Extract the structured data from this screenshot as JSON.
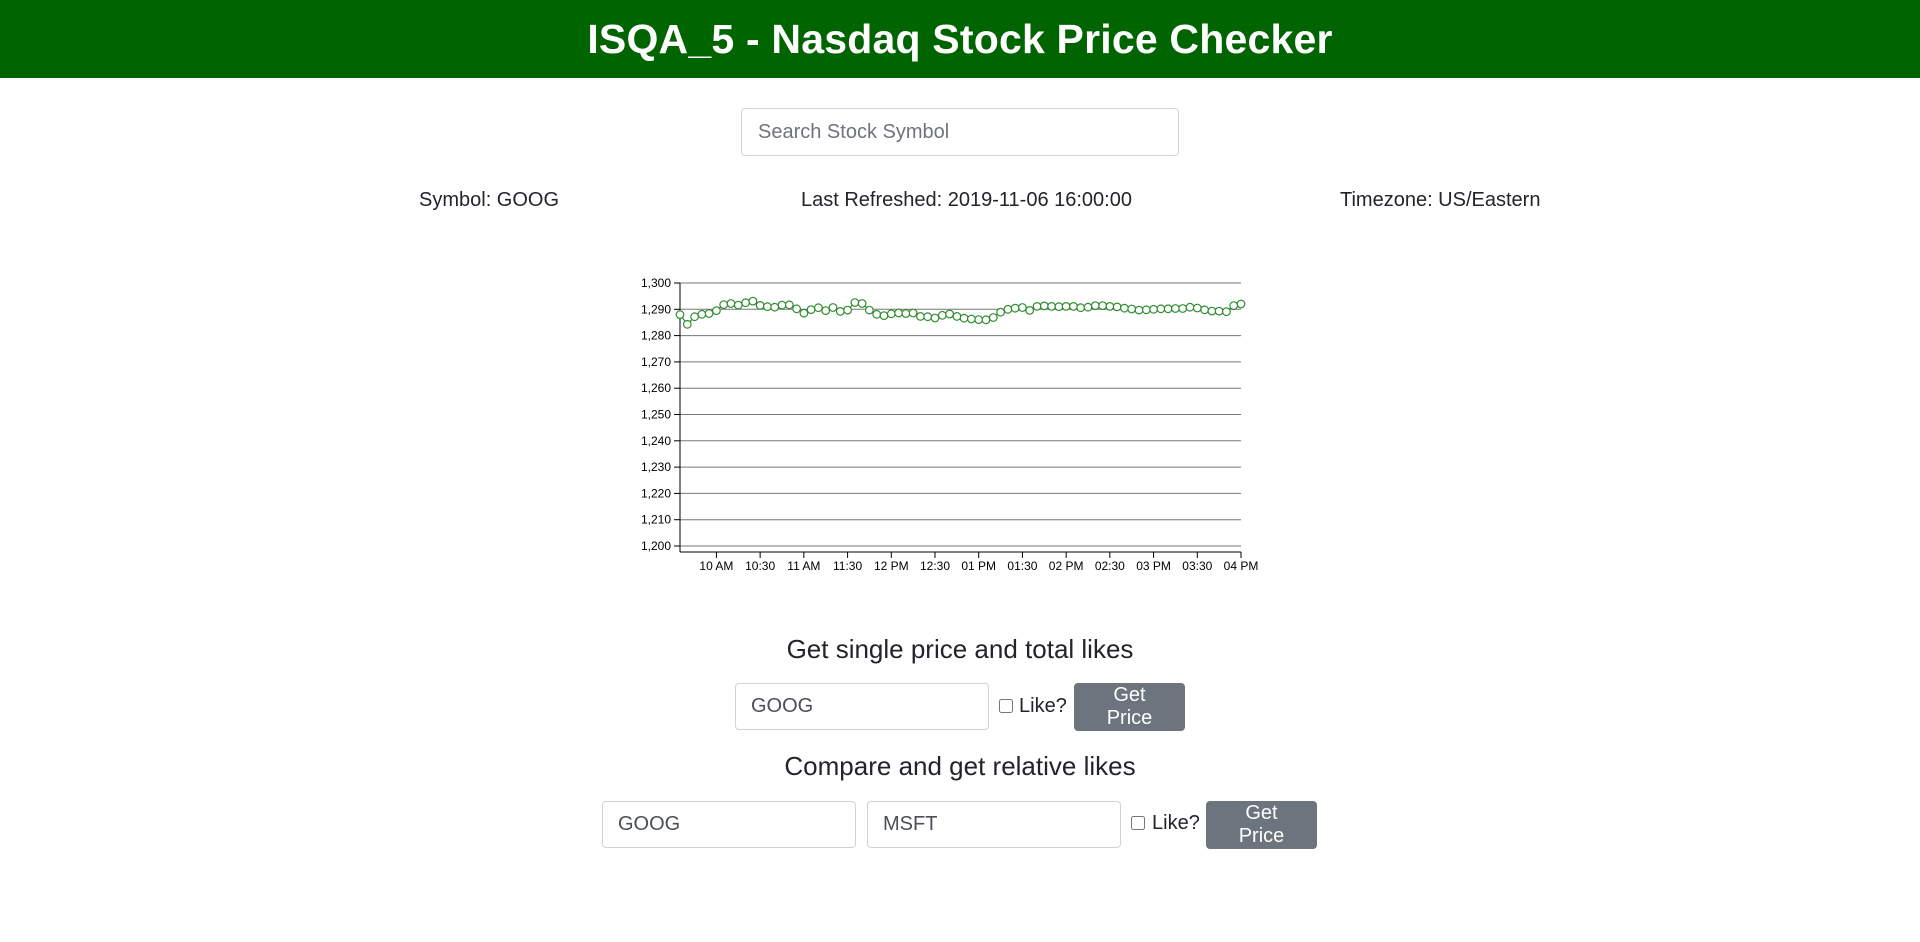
{
  "header": {
    "title": "ISQA_5 - Nasdaq Stock Price Checker"
  },
  "search": {
    "placeholder": "Search Stock Symbol",
    "value": ""
  },
  "info": {
    "symbol": "Symbol: GOOG",
    "last_refreshed": "Last Refreshed: 2019-11-06 16:00:00",
    "timezone": "Timezone: US/Eastern"
  },
  "colors": {
    "header_bg": "#006400",
    "line": "#2e8b2e",
    "button": "#6c757d"
  },
  "chart_data": {
    "type": "line",
    "title": "",
    "xlabel": "",
    "ylabel": "",
    "ylim": [
      1200,
      1300
    ],
    "yticks": [
      1200,
      1210,
      1220,
      1230,
      1240,
      1250,
      1260,
      1270,
      1280,
      1290,
      1300
    ],
    "ytick_labels": [
      "1,200",
      "1,210",
      "1,220",
      "1,230",
      "1,240",
      "1,250",
      "1,260",
      "1,270",
      "1,280",
      "1,290",
      "1,300"
    ],
    "xlim": [
      "09:35",
      "16:00"
    ],
    "xticks": [
      "10:00",
      "10:30",
      "11:00",
      "11:30",
      "12:00",
      "12:30",
      "13:00",
      "13:30",
      "14:00",
      "14:30",
      "15:00",
      "15:30",
      "16:00"
    ],
    "xtick_labels": [
      "10 AM",
      "10:30",
      "11 AM",
      "11:30",
      "12 PM",
      "12:30",
      "01 PM",
      "01:30",
      "02 PM",
      "02:30",
      "03 PM",
      "03:30",
      "04 PM"
    ],
    "grid": true,
    "markers": "open-circle",
    "series": [
      {
        "x": [
          "09:35",
          "09:40",
          "09:45",
          "09:50",
          "09:55",
          "10:00",
          "10:05",
          "10:10",
          "10:15",
          "10:20",
          "10:25",
          "10:30",
          "10:35",
          "10:40",
          "10:45",
          "10:50",
          "10:55",
          "11:00",
          "11:05",
          "11:10",
          "11:15",
          "11:20",
          "11:25",
          "11:30",
          "11:35",
          "11:40",
          "11:45",
          "11:50",
          "11:55",
          "12:00",
          "12:05",
          "12:10",
          "12:15",
          "12:20",
          "12:25",
          "12:30",
          "12:35",
          "12:40",
          "12:45",
          "12:50",
          "12:55",
          "13:00",
          "13:05",
          "13:10",
          "13:15",
          "13:20",
          "13:25",
          "13:30",
          "13:35",
          "13:40",
          "13:45",
          "13:50",
          "13:55",
          "14:00",
          "14:05",
          "14:10",
          "14:15",
          "14:20",
          "14:25",
          "14:30",
          "14:35",
          "14:40",
          "14:45",
          "14:50",
          "14:55",
          "15:00",
          "15:05",
          "15:10",
          "15:15",
          "15:20",
          "15:25",
          "15:30",
          "15:35",
          "15:40",
          "15:45",
          "15:50",
          "15:55",
          "16:00"
        ],
        "values": [
          1288.0,
          1284.3,
          1287.2,
          1288.1,
          1288.4,
          1289.5,
          1291.8,
          1292.2,
          1291.6,
          1292.5,
          1293.1,
          1291.5,
          1291.0,
          1290.8,
          1291.6,
          1291.7,
          1290.2,
          1288.5,
          1289.9,
          1290.6,
          1289.5,
          1290.7,
          1289.2,
          1289.7,
          1292.6,
          1292.2,
          1289.7,
          1288.1,
          1287.6,
          1288.3,
          1288.6,
          1288.4,
          1288.6,
          1287.3,
          1287.2,
          1286.7,
          1287.7,
          1288.2,
          1287.3,
          1286.6,
          1286.3,
          1286.1,
          1286.0,
          1286.9,
          1288.9,
          1290.0,
          1290.4,
          1290.7,
          1289.6,
          1291.1,
          1291.3,
          1291.1,
          1291.0,
          1291.1,
          1291.1,
          1290.6,
          1290.8,
          1291.4,
          1291.4,
          1291.1,
          1290.9,
          1290.4,
          1290.1,
          1289.7,
          1289.8,
          1290.0,
          1290.2,
          1290.2,
          1290.3,
          1290.3,
          1290.8,
          1290.5,
          1289.8,
          1289.3,
          1289.3,
          1289.1,
          1291.4,
          1292.0
        ]
      }
    ]
  },
  "single_form": {
    "title": "Get single price and total likes",
    "stock_value": "GOOG",
    "like_label": "Like?",
    "button_label": "Get Price"
  },
  "compare_form": {
    "title": "Compare and get relative likes",
    "stock1_value": "GOOG",
    "stock2_value": "MSFT",
    "like_label": "Like?",
    "button_label": "Get Price"
  }
}
